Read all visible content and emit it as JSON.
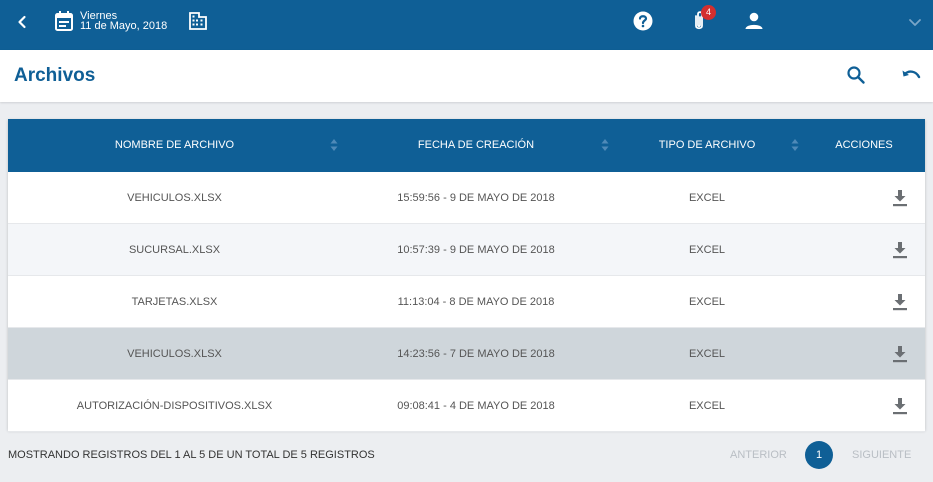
{
  "topbar": {
    "day": "Viernes",
    "date": "11 de Mayo, 2018",
    "notification_count": "4"
  },
  "page": {
    "title": "Archivos"
  },
  "table": {
    "headers": [
      "NOMBRE DE ARCHIVO",
      "FECHA DE CREACIÓN",
      "TIPO DE ARCHIVO",
      "ACCIONES"
    ],
    "rows": [
      {
        "name": "VEHICULOS.XLSX",
        "date": "15:59:56 - 9 DE MAYO DE 2018",
        "type": "EXCEL",
        "highlighted": false
      },
      {
        "name": "SUCURSAL.XLSX",
        "date": "10:57:39 - 9 DE MAYO DE 2018",
        "type": "EXCEL",
        "highlighted": false
      },
      {
        "name": "TARJETAS.XLSX",
        "date": "11:13:04 - 8 DE MAYO DE 2018",
        "type": "EXCEL",
        "highlighted": false
      },
      {
        "name": "VEHICULOS.XLSX",
        "date": "14:23:56 - 7 DE MAYO DE 2018",
        "type": "EXCEL",
        "highlighted": true
      },
      {
        "name": "AUTORIZACIÓN-DISPOSITIVOS.XLSX",
        "date": "09:08:41 - 4 DE MAYO DE 2018",
        "type": "EXCEL",
        "highlighted": false
      }
    ]
  },
  "footer": {
    "summary": "MOSTRANDO REGISTROS DEL 1 AL 5 DE UN TOTAL DE 5 REGISTROS",
    "prev_label": "ANTERIOR",
    "current_page": "1",
    "next_label": "SIGUIENTE"
  },
  "colors": {
    "primary": "#0f5f96",
    "row_alt": "#f4f6f9",
    "row_highlight": "#cfd6db",
    "badge": "#d32f2f"
  }
}
